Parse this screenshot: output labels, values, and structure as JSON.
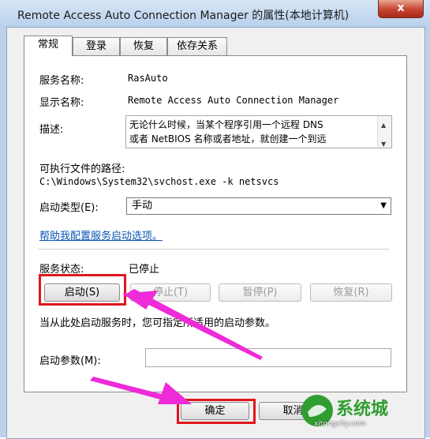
{
  "window": {
    "title": "Remote Access Auto Connection Manager 的属性(本地计算机)",
    "close_label": "x"
  },
  "tabs": [
    {
      "label": "常规",
      "active": true
    },
    {
      "label": "登录",
      "active": false
    },
    {
      "label": "恢复",
      "active": false
    },
    {
      "label": "依存关系",
      "active": false
    }
  ],
  "general": {
    "service_name_label": "服务名称:",
    "service_name": "RasAuto",
    "display_name_label": "显示名称:",
    "display_name": "Remote Access Auto Connection Manager",
    "description_label": "描述:",
    "description_line1": "无论什么时候，当某个程序引用一个远程 DNS",
    "description_line2": "或者 NetBIOS 名称或者地址，就创建一个到远",
    "exe_path_label": "可执行文件的路径:",
    "exe_path": "C:\\Windows\\System32\\svchost.exe -k netsvcs",
    "startup_type_label": "启动类型(E):",
    "startup_type_value": "手动",
    "help_link": "帮助我配置服务启动选项。",
    "status_label": "服务状态:",
    "status_value": "已停止",
    "buttons": {
      "start": "启动(S)",
      "stop": "停止(T)",
      "pause": "暂停(P)",
      "resume": "恢复(R)"
    },
    "hint": "当从此处启动服务时，您可指定所适用的启动参数。",
    "start_params_label": "启动参数(M):",
    "start_params_value": ""
  },
  "footer": {
    "ok": "确定",
    "cancel": "取消"
  },
  "watermark": {
    "text": "系统城",
    "url": "xitongcity.com"
  },
  "colors": {
    "highlight_box": "#e0161f",
    "arrow": "#ee2bd8",
    "link": "#0a56b4"
  }
}
